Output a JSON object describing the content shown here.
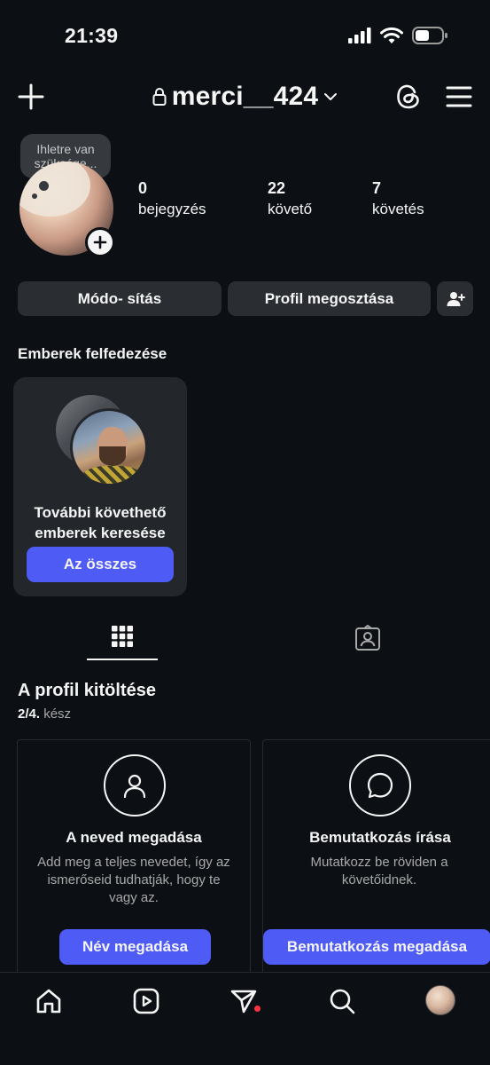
{
  "status_bar": {
    "time": "21:39"
  },
  "header": {
    "username": "merci__424"
  },
  "profile": {
    "note": "Ihletre van szüksége...",
    "stats": [
      {
        "value": "0",
        "label": "bejegyzés"
      },
      {
        "value": "22",
        "label": "követő"
      },
      {
        "value": "7",
        "label": "követés"
      }
    ]
  },
  "actions": {
    "edit_label": "Módo- sítás",
    "share_label": "Profil megosztása"
  },
  "discover": {
    "title": "Emberek felfedezése",
    "card_text_line1": "További követhető",
    "card_text_line2": "emberek keresése",
    "button_label": "Az összes"
  },
  "completion": {
    "title": "A profil kitöltése",
    "progress_count": "2/4.",
    "progress_suffix": "kész",
    "cards": [
      {
        "icon": "person-icon",
        "title": "A neved megadása",
        "description": "Add meg a teljes nevedet, így az ismerőseid tudhatják, hogy te vagy az.",
        "button_label": "Név megadása"
      },
      {
        "icon": "chat-bubble-icon",
        "title": "Bemutatkozás írása",
        "description": "Mutatkozz be röviden a követőidnek.",
        "button_label": "Bemutatkozás megadása"
      }
    ]
  },
  "colors": {
    "background": "#0c1014",
    "button": "#2a2e33",
    "accent": "#4f5bf5",
    "notification": "#ff3040"
  }
}
